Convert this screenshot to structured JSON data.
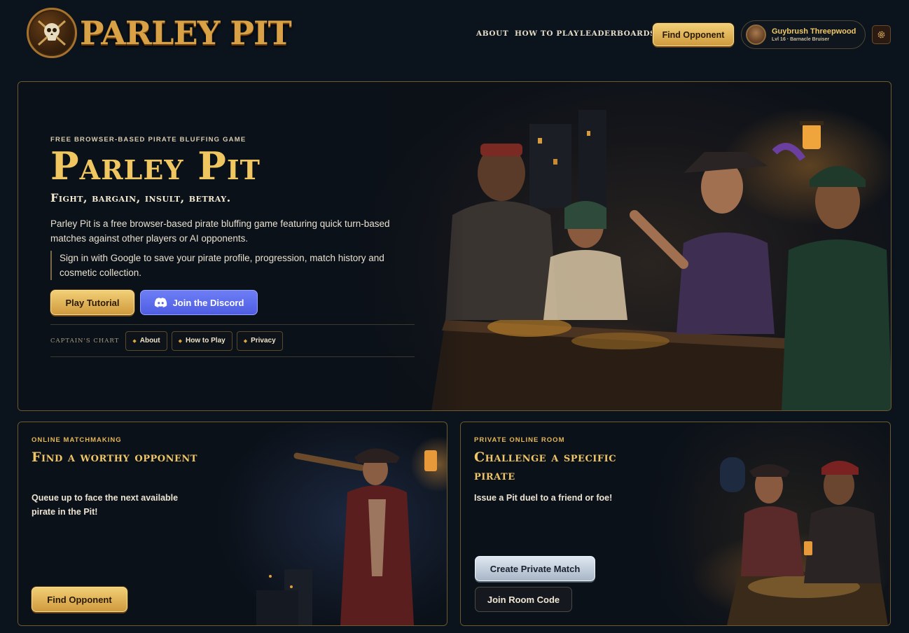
{
  "header": {
    "brand": "PARLEY PIT",
    "nav": [
      {
        "label": "ABOUT"
      },
      {
        "label": "HOW TO PLAY"
      },
      {
        "label": "LEADERBOARDS"
      }
    ],
    "find_opponent_label": "Find Opponent",
    "profile": {
      "name": "Guybrush Threepwood",
      "subtitle": "Lvl 16 · Barnacle Bruiser"
    },
    "icons": {
      "settings": "gear-icon",
      "logo": "skull-crossed-swords-icon"
    }
  },
  "hero": {
    "eyebrow": "FREE BROWSER-BASED PIRATE BLUFFING GAME",
    "title": "Parley Pit",
    "tagline": "Fight, bargain, insult, betray.",
    "description": "Parley Pit is a free browser-based pirate bluffing game featuring quick turn-based matches against other players or AI opponents.",
    "note": "Sign in with Google to save your pirate profile, progression, match history and cosmetic collection.",
    "tutorial_label": "Play Tutorial",
    "discord_label": "Join the Discord",
    "captains_chart_label": "CAPTAIN'S CHART",
    "chart_links": [
      {
        "label": "About"
      },
      {
        "label": "How to Play"
      },
      {
        "label": "Privacy"
      }
    ]
  },
  "matchmaking": {
    "eyebrow": "ONLINE MATCHMAKING",
    "title": "Find a worthy opponent",
    "description": "Queue up to face the next available pirate in the Pit!",
    "button_label": "Find Opponent"
  },
  "private_room": {
    "eyebrow": "PRIVATE ONLINE ROOM",
    "title": "Challenge a specific pirate",
    "description": "Issue a Pit duel to a friend or foe!",
    "create_label": "Create Private Match",
    "join_label": "Join Room Code"
  },
  "colors": {
    "background": "#0b131d",
    "gold": "#f0c661",
    "panel_border": "#6e5a2c",
    "discord": "#5865f2"
  }
}
